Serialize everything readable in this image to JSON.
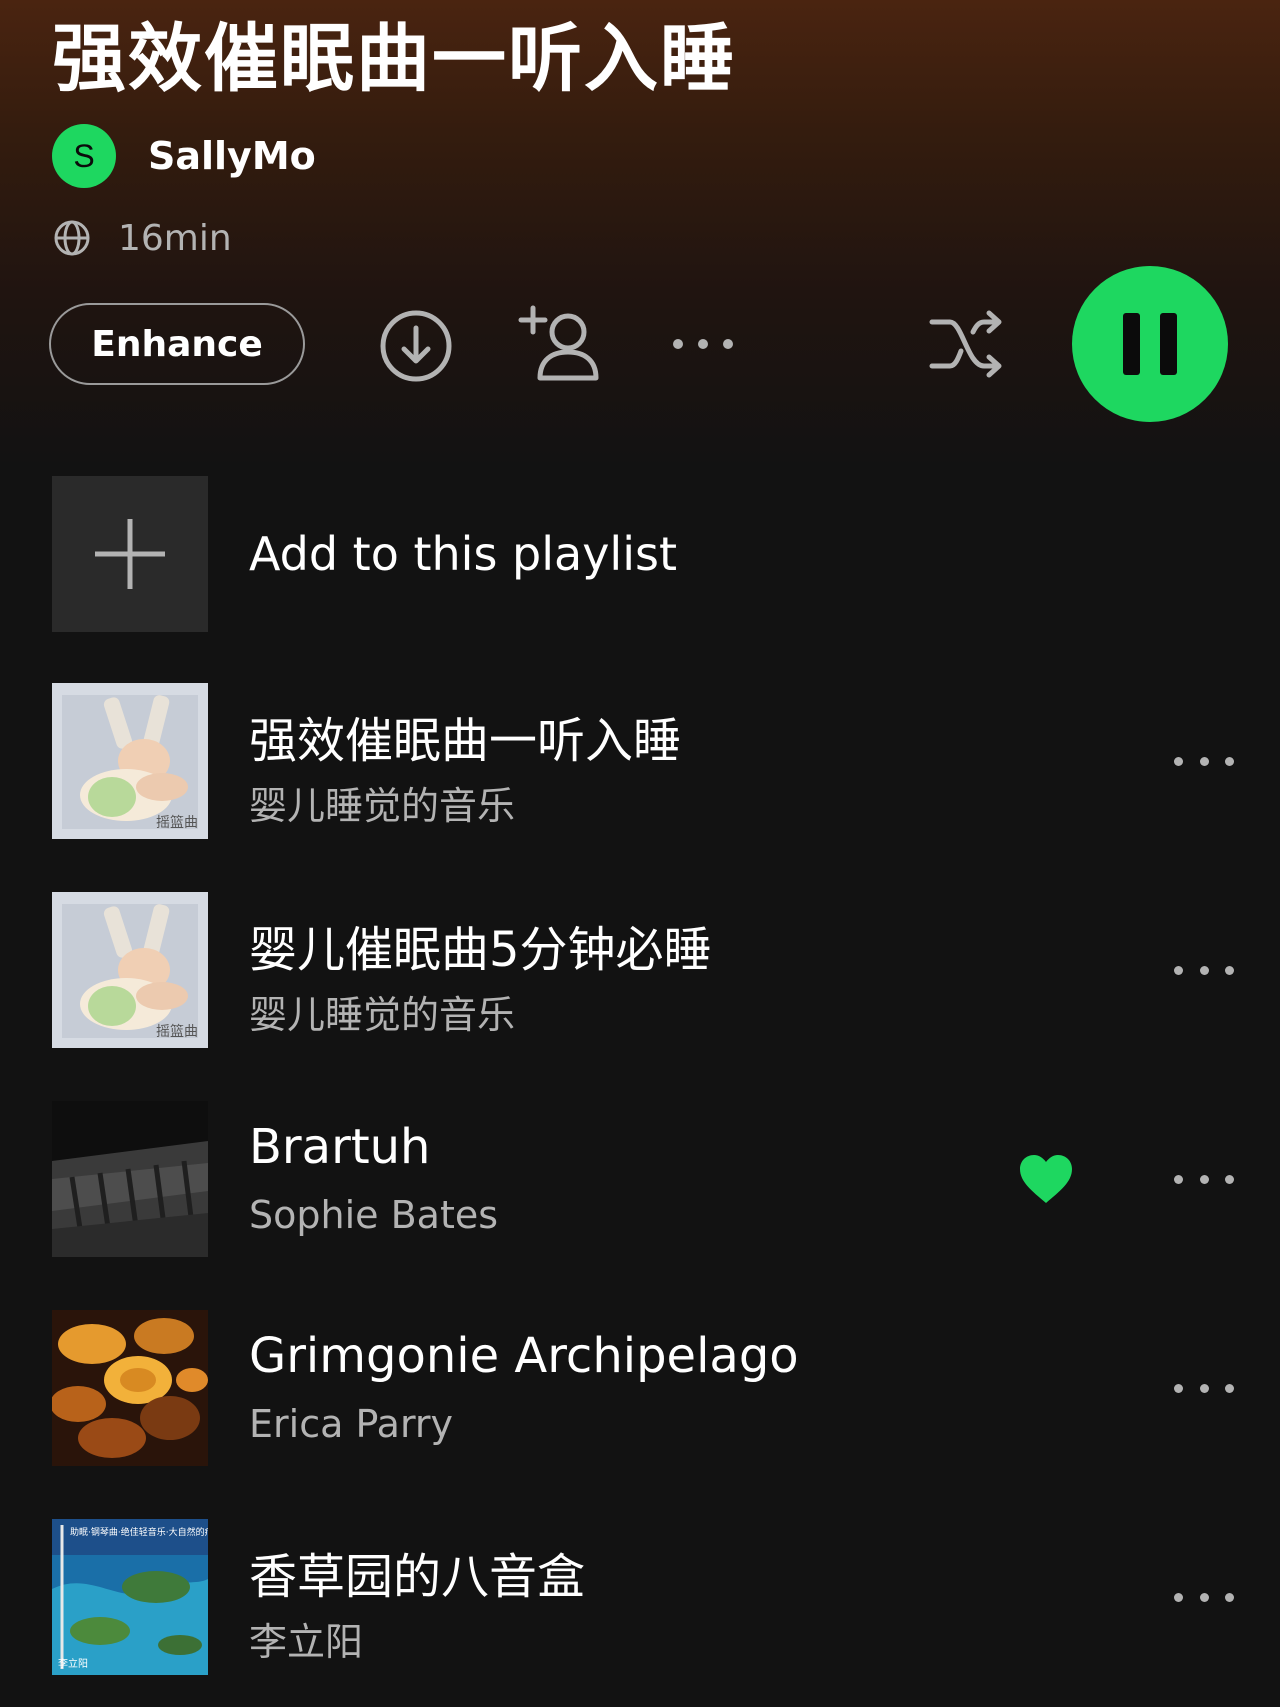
{
  "header": {
    "title": "强效催眠曲一听入睡",
    "owner_initial": "S",
    "owner_name": "SallyMo",
    "duration": "16min"
  },
  "actions": {
    "enhance_label": "Enhance",
    "icons": [
      "globe-icon",
      "download-icon",
      "add-collaborator-icon",
      "more-options-icon",
      "shuffle-icon",
      "pause-icon"
    ],
    "accent_color": "#1ed760"
  },
  "add_row": {
    "label": "Add to this playlist"
  },
  "tracks": [
    {
      "title": "强效催眠曲一听入睡",
      "artist": "婴儿睡觉的音乐",
      "art_text": "摇篮曲",
      "liked": false
    },
    {
      "title": "婴儿催眠曲5分钟必睡",
      "artist": "婴儿睡觉的音乐",
      "art_text": "摇篮曲",
      "liked": false
    },
    {
      "title": "Brartuh",
      "artist": "Sophie Bates",
      "liked": true
    },
    {
      "title": "Grimgonie Archipelago",
      "artist": "Erica Parry",
      "liked": false
    },
    {
      "title": "香草园的八音盒",
      "artist": "李立阳",
      "art_text_top": "助眠·钢琴曲·绝佳轻音乐·大自然的疗愈催眠曲",
      "art_text_bottom": "李立阳",
      "liked": false
    }
  ]
}
